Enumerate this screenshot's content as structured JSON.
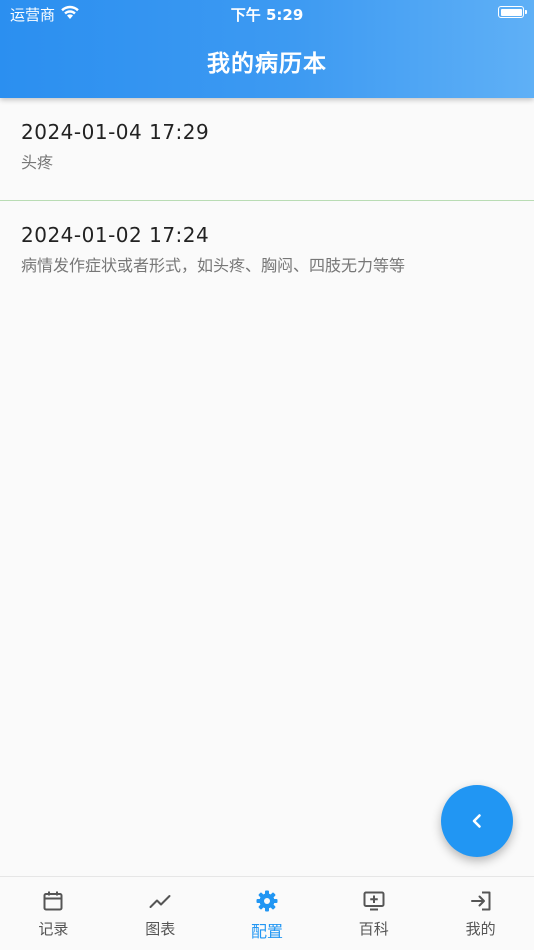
{
  "status_bar": {
    "carrier": "运营商",
    "time": "下午 5:29",
    "icons": [
      "wifi-icon",
      "battery-icon"
    ]
  },
  "header": {
    "title": "我的病历本"
  },
  "records": [
    {
      "date": "2024-01-04 17:29",
      "description": "头疼"
    },
    {
      "date": "2024-01-02 17:24",
      "description": "病情发作症状或者形式，如头疼、胸闷、四肢无力等等"
    }
  ],
  "fab": {
    "icon": "chevron-left-icon"
  },
  "tab_bar": {
    "items": [
      {
        "label": "记录",
        "icon": "calendar-icon"
      },
      {
        "label": "图表",
        "icon": "trending-up-icon"
      },
      {
        "label": "配置",
        "icon": "gear-icon"
      },
      {
        "label": "百科",
        "icon": "add-to-queue-icon"
      },
      {
        "label": "我的",
        "icon": "login-icon"
      }
    ],
    "active_index": 2
  },
  "colors": {
    "accent": "#2196f3",
    "header_gradient_start": "#2b8ff0",
    "header_gradient_end": "#5fb0f6",
    "divider": "#b9dcb4"
  }
}
